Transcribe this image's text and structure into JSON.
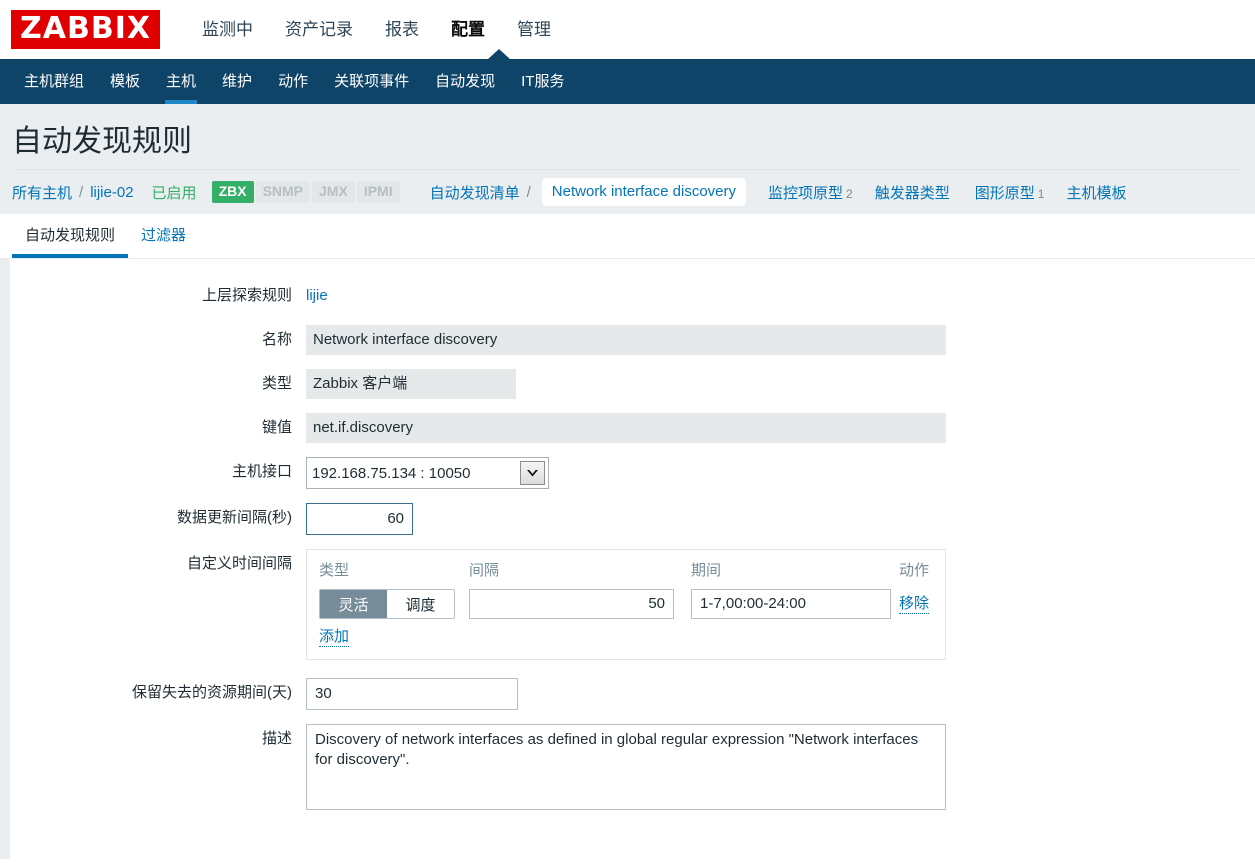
{
  "brand": {
    "logo_text": "ZABBIX",
    "logo_bg": "#e10000"
  },
  "main_menu": [
    {
      "label": "监测中",
      "selected": false
    },
    {
      "label": "资产记录",
      "selected": false
    },
    {
      "label": "报表",
      "selected": false
    },
    {
      "label": "配置",
      "selected": true
    },
    {
      "label": "管理",
      "selected": false
    }
  ],
  "sub_menu": [
    {
      "label": "主机群组",
      "selected": false
    },
    {
      "label": "模板",
      "selected": false
    },
    {
      "label": "主机",
      "selected": true
    },
    {
      "label": "维护",
      "selected": false
    },
    {
      "label": "动作",
      "selected": false
    },
    {
      "label": "关联项事件",
      "selected": false
    },
    {
      "label": "自动发现",
      "selected": false
    },
    {
      "label": "IT服务",
      "selected": false
    }
  ],
  "page": {
    "title": "自动发现规则"
  },
  "breadcrumb": {
    "all_hosts": "所有主机",
    "separator": "/",
    "host": "lijie-02",
    "status": "已启用",
    "interfaces": [
      {
        "label": "ZBX",
        "active": true
      },
      {
        "label": "SNMP",
        "active": false
      },
      {
        "label": "JMX",
        "active": false
      },
      {
        "label": "IPMI",
        "active": false
      }
    ],
    "discovery_list": "自动发现清单",
    "current": "Network interface discovery",
    "links": [
      {
        "label": "监控项原型",
        "count": "2"
      },
      {
        "label": "触发器类型",
        "count": ""
      },
      {
        "label": "图形原型",
        "count": "1"
      },
      {
        "label": "主机模板",
        "count": ""
      }
    ]
  },
  "tabs": [
    {
      "label": "自动发现规则",
      "active": true
    },
    {
      "label": "过滤器",
      "active": false
    }
  ],
  "form": {
    "parent_label": "上层探索规则",
    "parent_value": "lijie",
    "name_label": "名称",
    "name_value": "Network interface discovery",
    "type_label": "类型",
    "type_value": "Zabbix 客户端",
    "key_label": "键值",
    "key_value": "net.if.discovery",
    "interface_label": "主机接口",
    "interface_value": "192.168.75.134 : 10050",
    "update_interval_label": "数据更新间隔(秒)",
    "update_interval_value": "60",
    "custom_intervals_label": "自定义时间间隔",
    "custom_intervals": {
      "headers": {
        "type": "类型",
        "interval": "间隔",
        "period": "期间",
        "action": "动作"
      },
      "rows": [
        {
          "mode_flexible": "灵活",
          "mode_scheduling": "调度",
          "mode_selected": "灵活",
          "interval": "50",
          "period": "1-7,00:00-24:00",
          "remove_label": "移除"
        }
      ],
      "add_label": "添加"
    },
    "keep_lost_label": "保留失去的资源期间(天)",
    "keep_lost_value": "30",
    "description_label": "描述",
    "description_value": "Discovery of network interfaces as defined in global regular expression \"Network interfaces for discovery\"."
  },
  "colors": {
    "accent_blue": "#0275b8",
    "navbar_blue": "#0f4469",
    "active_underline": "#1f87c8",
    "green": "#34af67",
    "page_bg": "#ebeef0"
  }
}
